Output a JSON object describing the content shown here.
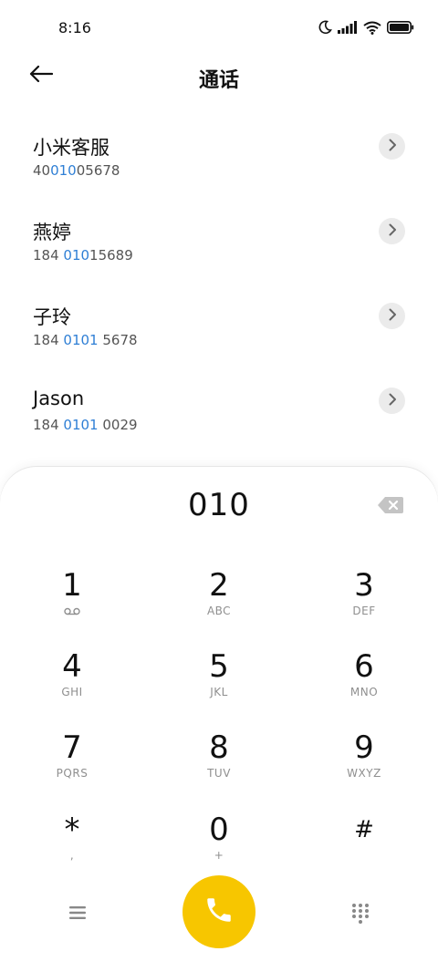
{
  "status_bar": {
    "time": "8:16",
    "icons": [
      "moon-icon",
      "signal-icon",
      "wifi-icon",
      "battery-icon"
    ]
  },
  "header": {
    "title": "通话",
    "back_icon": "arrow-left-icon"
  },
  "contacts": [
    {
      "name": "小米客服",
      "number_parts": [
        "40",
        "010",
        "05678"
      ]
    },
    {
      "name": "燕婷",
      "number_parts": [
        "184 ",
        "010",
        "15689"
      ]
    },
    {
      "name": "子玲",
      "number_parts": [
        "184 ",
        "0101",
        " 5678"
      ]
    },
    {
      "name": "Jason",
      "number_parts": [
        "184 ",
        "0101",
        " 0029"
      ]
    }
  ],
  "dialer": {
    "input_value": "010",
    "keys": [
      {
        "digit": "1",
        "letters": "",
        "icon": "voicemail-icon"
      },
      {
        "digit": "2",
        "letters": "ABC"
      },
      {
        "digit": "3",
        "letters": "DEF"
      },
      {
        "digit": "4",
        "letters": "GHI"
      },
      {
        "digit": "5",
        "letters": "JKL"
      },
      {
        "digit": "6",
        "letters": "MNO"
      },
      {
        "digit": "7",
        "letters": "PQRS"
      },
      {
        "digit": "8",
        "letters": "TUV"
      },
      {
        "digit": "9",
        "letters": "WXYZ"
      },
      {
        "digit": "*",
        "letters": ","
      },
      {
        "digit": "0",
        "letters": "+"
      },
      {
        "digit": "#",
        "letters": ""
      }
    ]
  },
  "colors": {
    "highlight": "#2f7fd5",
    "call_button": "#f7c600",
    "arrow_bg": "#ebebeb"
  }
}
